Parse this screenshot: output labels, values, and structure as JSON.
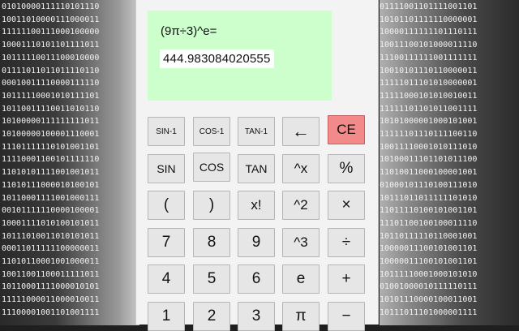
{
  "background": {
    "left_lines": [
      "01010000111110101110",
      "10011010000111000011",
      "11111100111000100000",
      "10001110101101111011",
      "10111110011100010000",
      "01111011011011110110",
      "00010011110000111110",
      "10111110001010111101",
      "10110011110011010110",
      "10100000111111111011",
      "10100000100001110001",
      "11101111110101001101",
      "11110001100101111110",
      "11010101111001001011",
      "11010111000010100101",
      "10110001111001000111",
      "00101111110000100001",
      "10001111010100101011",
      "10111010011010101011",
      "00011011111100000011",
      "11010110001001000011",
      "10011001100011111011",
      "10110001111000010101",
      "11111000011000010011",
      "11100001001101001111"
    ],
    "right_lines": [
      "01111001101111001101",
      "10101101111110000001",
      "10000111111101110111",
      "10011100101000011110",
      "11100111111001111111",
      "10010101110110000011",
      "11111011101010000001",
      "11111000101010010011",
      "11111101101011001111",
      "10101000001000101001",
      "11111101110111100110",
      "10011110001010111010",
      "10100011101101011100",
      "11010011000100001001",
      "01000101110100111010",
      "10111011011111101010",
      "11011110100101001101",
      "11101100100100011110",
      "10110111110110001001",
      "10000011100101001101",
      "10000011100101001101",
      "10111110001000101010",
      "01001000010111110111",
      "10101110000100011001",
      "10111011101000001111"
    ]
  },
  "display": {
    "expression": "(9π÷3)^e=",
    "result": "444.983084020555",
    "bg_color": "#ccffcc"
  },
  "keys": [
    [
      "SIN-1",
      "COS-1",
      "TAN-1",
      "←",
      "CE"
    ],
    [
      "SIN",
      "COS",
      "TAN",
      "^x",
      "%"
    ],
    [
      "(",
      ")",
      "x!",
      "^2",
      "×"
    ],
    [
      "7",
      "8",
      "9",
      "^3",
      "÷"
    ],
    [
      "4",
      "5",
      "6",
      "e",
      "+"
    ],
    [
      "1",
      "2",
      "3",
      "π",
      "−"
    ]
  ],
  "colors": {
    "ce_button": "#f28a8a"
  }
}
